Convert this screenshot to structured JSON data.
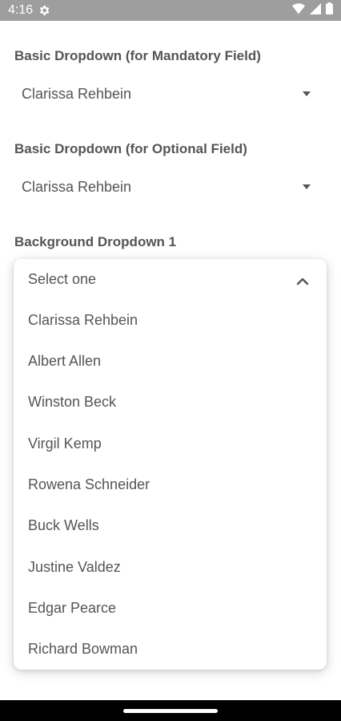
{
  "status_bar": {
    "time": "4:16",
    "icons": [
      "gear-icon",
      "wifi-icon",
      "signal-icon",
      "battery-icon"
    ],
    "color": "#9e9e9e"
  },
  "mandatory": {
    "label": "Basic Dropdown (for Mandatory Field)",
    "value": "Clarissa Rehbein"
  },
  "optional": {
    "label": "Basic Dropdown (for Optional Field)",
    "value": "Clarissa Rehbein"
  },
  "background": {
    "label": "Background Dropdown 1",
    "placeholder": "Select one",
    "options": [
      "Clarissa Rehbein",
      "Albert Allen",
      "Winston Beck",
      "Virgil Kemp",
      "Rowena Schneider",
      "Buck Wells",
      "Justine Valdez",
      "Edgar Pearce",
      "Richard Bowman"
    ]
  }
}
